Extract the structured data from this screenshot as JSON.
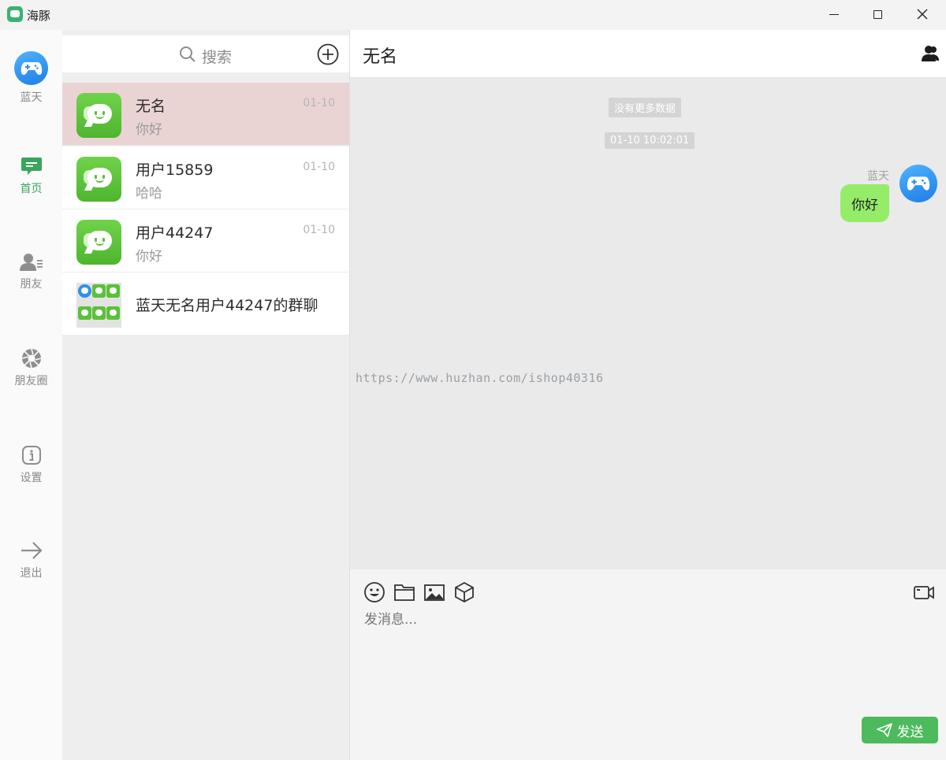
{
  "window": {
    "title": "海豚"
  },
  "nav": {
    "user_label": "蓝天",
    "items": [
      {
        "label": "首页",
        "icon": "chat-icon",
        "active": true
      },
      {
        "label": "朋友",
        "icon": "contacts-icon",
        "active": false
      },
      {
        "label": "朋友圈",
        "icon": "moments-icon",
        "active": false
      },
      {
        "label": "设置",
        "icon": "info-icon",
        "active": false
      },
      {
        "label": "退出",
        "icon": "arrow-right-icon",
        "active": false
      }
    ]
  },
  "search": {
    "placeholder": "搜索"
  },
  "conversations": [
    {
      "name": "无名",
      "last_message": "你好",
      "date": "01-10",
      "selected": true
    },
    {
      "name": "用户15859",
      "last_message": "哈哈",
      "date": "01-10",
      "selected": false
    },
    {
      "name": "用户44247",
      "last_message": "你好",
      "date": "01-10",
      "selected": false
    },
    {
      "name": "蓝天无名用户44247的群聊",
      "last_message": "",
      "date": "",
      "selected": false
    }
  ],
  "chat": {
    "title": "无名",
    "no_more": "没有更多数据",
    "timestamp": "01-10 10:02:01",
    "messages": [
      {
        "sender": "蓝天",
        "text": "你好",
        "self": true
      }
    ],
    "watermark": "https://www.huzhan.com/ishop40316",
    "input_placeholder": "发消息...",
    "send_label": "发送"
  },
  "colors": {
    "accent": "#3aa55d",
    "send_button": "#4cba5d",
    "own_bubble": "#95ec69",
    "selected_row": "#ead3d3"
  }
}
